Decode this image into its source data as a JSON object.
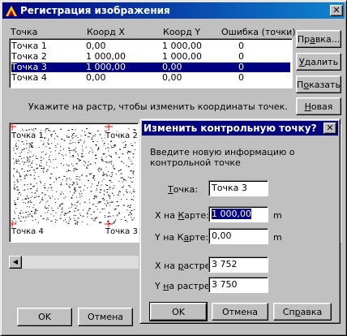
{
  "window": {
    "title": "Регистрация изображения",
    "close_glyph": "✕"
  },
  "grid": {
    "columns": [
      "Точка",
      "Коорд X",
      "Коорд Y",
      "Ошибка (точки)"
    ],
    "rows": [
      {
        "name": "Точка 1",
        "x": "0,00",
        "y": "1 000,00",
        "err": "0",
        "selected": false
      },
      {
        "name": "Точка 2",
        "x": "1 000,00",
        "y": "1 000,00",
        "err": "0",
        "selected": false
      },
      {
        "name": "Точка 3",
        "x": "1 000,00",
        "y": "0,00",
        "err": "0",
        "selected": true
      },
      {
        "name": "Точка 4",
        "x": "0,00",
        "y": "0,00",
        "err": "0",
        "selected": false
      }
    ]
  },
  "side_buttons": {
    "edit": {
      "pre": "Пр",
      "key": "а",
      "post": "вка..."
    },
    "delete": {
      "pre": "",
      "key": "У",
      "post": "далить"
    },
    "show": {
      "pre": "П",
      "key": "о",
      "post": "казать"
    },
    "new": {
      "pre": "",
      "key": "Н",
      "post": "овая"
    }
  },
  "hint": "Укажите на растр, чтобы изменить координаты точек.",
  "raster": {
    "labels": [
      "Точка 1",
      "Точка 2",
      "Точка 4",
      "Точка 3"
    ]
  },
  "bottom": {
    "ok": "OK",
    "cancel": "Отмена"
  },
  "dialog": {
    "title": "Изменить контрольную точку?",
    "close_glyph": "✕",
    "info": "Введите новую информацию о контрольной точке",
    "point_label": {
      "key": "Т",
      "post": "очка:"
    },
    "point_value": "Точка 3",
    "x_map_label": {
      "pre": "X на ",
      "key": "К",
      "post": "арте:"
    },
    "x_map_value": "1 000,00",
    "y_map_label": {
      "pre": "Y на К",
      "key": "а",
      "post": "рте:"
    },
    "y_map_value": "0,00",
    "unit_x": "m",
    "unit_y": "m",
    "x_raster_label": {
      "pre": "X на ",
      "key": "р",
      "post": "астре:"
    },
    "x_raster_value": "3 752",
    "y_raster_label": {
      "pre": "Y ",
      "key": "н",
      "post": "а растре:"
    },
    "y_raster_value": "3 750",
    "ok": "OK",
    "cancel": "Отмена",
    "help": {
      "pre": "Сп",
      "key": "р",
      "post": "авка"
    }
  },
  "colors": {
    "face": "#c0c0c0",
    "title_active": "#000080",
    "selection": "#000080",
    "marker": "#ff0000"
  }
}
